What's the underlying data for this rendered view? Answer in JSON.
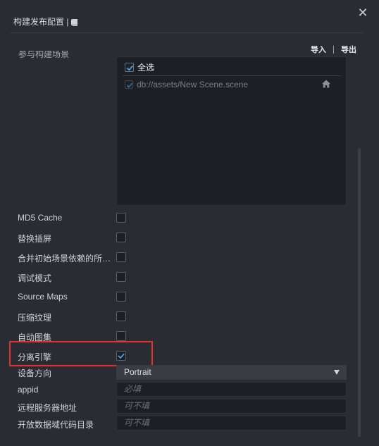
{
  "header": {
    "title": "构建发布配置 |",
    "close_symbol": "✕"
  },
  "toolbar": {
    "import_label": "导入",
    "export_label": "导出"
  },
  "scenes": {
    "section_label": "参与构建场景",
    "select_all_label": "全选",
    "select_all_checked": true,
    "items": [
      {
        "path": "db://assets/New Scene.scene",
        "checked": true,
        "is_start": true
      }
    ]
  },
  "options": [
    {
      "label": "MD5 Cache",
      "checked": false
    },
    {
      "label": "替换插屏",
      "checked": false
    },
    {
      "label": "合并初始场景依赖的所…",
      "checked": false
    },
    {
      "label": "调试模式",
      "checked": false
    },
    {
      "label": "Source Maps",
      "checked": false
    },
    {
      "label": "压缩纹理",
      "checked": false
    },
    {
      "label": "自动图集",
      "checked": false
    },
    {
      "label": "分离引擎",
      "checked": true
    }
  ],
  "fields": {
    "orientation": {
      "label": "设备方向",
      "value": "Portrait"
    },
    "appid": {
      "label": "appid",
      "placeholder": "必填"
    },
    "remote_server": {
      "label": "远程服务器地址",
      "placeholder": "可不填"
    },
    "open_data_dir": {
      "label": "开放数据域代码目录",
      "placeholder": "可不填"
    }
  },
  "colors": {
    "accent_check": "#4ea3e0",
    "highlight_border": "#e2332f",
    "panel_bg": "#2a2c33",
    "input_bg": "#1d1f26"
  }
}
